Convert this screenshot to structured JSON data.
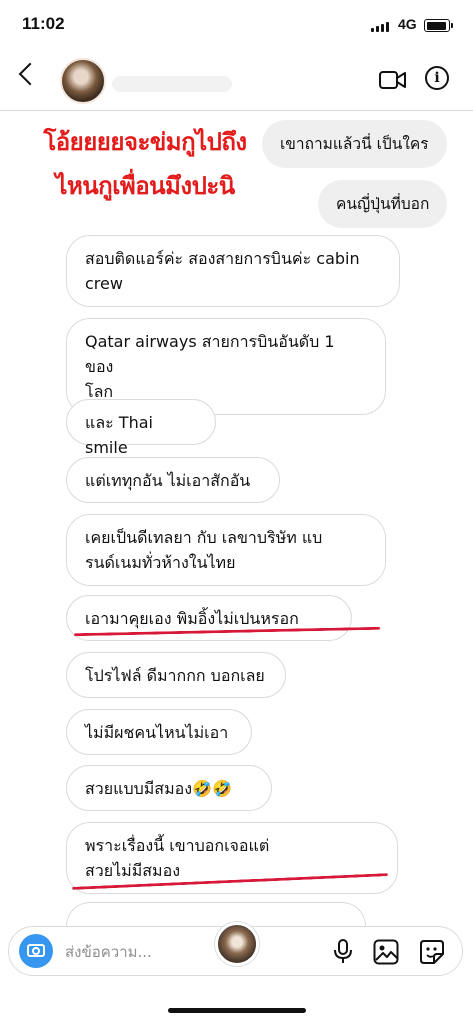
{
  "status_bar": {
    "time": "11:02",
    "network": "4G"
  },
  "caption": {
    "line1": "โอ้ยยยยจะข่มกูไปถึง",
    "line2": "ไหนกูเพื่อนมึงปะนิ"
  },
  "sent_messages": [
    {
      "text": "เขาถามแล้วนี่ เป็นใคร"
    },
    {
      "text": "คนญี่ปุ่นที่บอก"
    }
  ],
  "received_messages": [
    {
      "lines": [
        "สอบติดแอร์ค่ะ สองสายการบินค่ะ cabin",
        "crew"
      ]
    },
    {
      "lines": [
        "Qatar airways สายการบินอันดับ 1 ของ",
        "โลก"
      ]
    },
    {
      "lines": [
        "และ Thai smile"
      ]
    },
    {
      "lines": [
        "แต่เททุกอัน ไม่เอาสักอัน"
      ]
    },
    {
      "lines": [
        "เคยเป็นดีเทลยา กับ เลขาบริษัท แบ",
        "รนด์เนมทั่วห้างในไทย"
      ]
    },
    {
      "lines": [
        "เอามาคุยเอง     พิมอิ้งไม่เปนหรอก"
      ]
    },
    {
      "lines": [
        "โปรไฟล์   ดีมากกก บอกเลย"
      ]
    },
    {
      "lines": [
        "ไม่มีผชคนไหนไม่เอา"
      ]
    },
    {
      "lines": [
        "สวยแบบมีสมอง🤣🤣"
      ]
    },
    {
      "lines": [
        "            พราะเรื่องนี้ เขาบอกเจอแต่",
        "สวยไม่มีสมอง"
      ]
    }
  ],
  "input": {
    "placeholder": "ส่งข้อความ..."
  },
  "icons": {
    "back": "chevron-left-icon",
    "video": "video-call-icon",
    "info": "info-icon",
    "camera": "camera-icon",
    "mic": "microphone-icon",
    "gallery": "gallery-icon",
    "sticker": "sticker-icon"
  },
  "colors": {
    "caption": "#e31b1b",
    "underline": "#d81838",
    "camera_button": "#3797f0"
  }
}
